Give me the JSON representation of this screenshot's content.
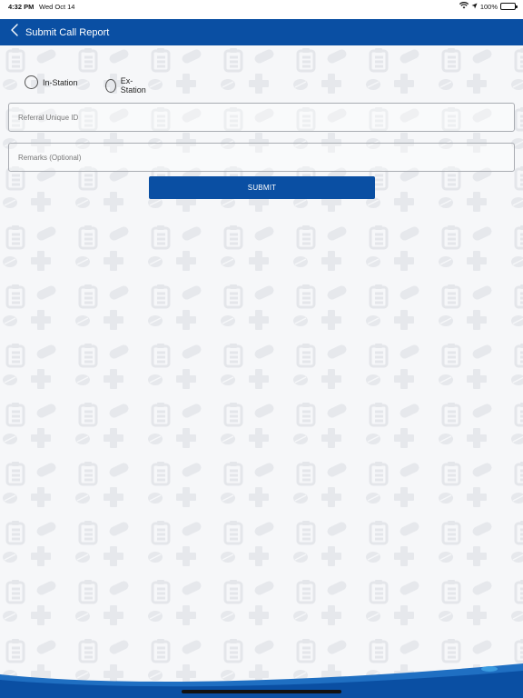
{
  "status_bar": {
    "time": "4:32 PM",
    "date": "Wed Oct 14",
    "battery": "100%",
    "icons": [
      "wifi-icon",
      "location-icon",
      "battery-icon"
    ]
  },
  "nav": {
    "title": "Submit Call Report",
    "back_icon": "chevron-left-icon"
  },
  "form": {
    "options": [
      {
        "label": "In-Station",
        "selected": false
      },
      {
        "label": "Ex-Station",
        "selected": false
      }
    ],
    "referral_placeholder": "Referral Unique ID",
    "referral_value": "",
    "remarks_placeholder": "Remarks (Optional)",
    "remarks_value": "",
    "submit_label": "SUBMIT"
  },
  "colors": {
    "primary": "#0a4fa3",
    "background": "#f6f7f9",
    "pattern": "#e6e8ec"
  }
}
